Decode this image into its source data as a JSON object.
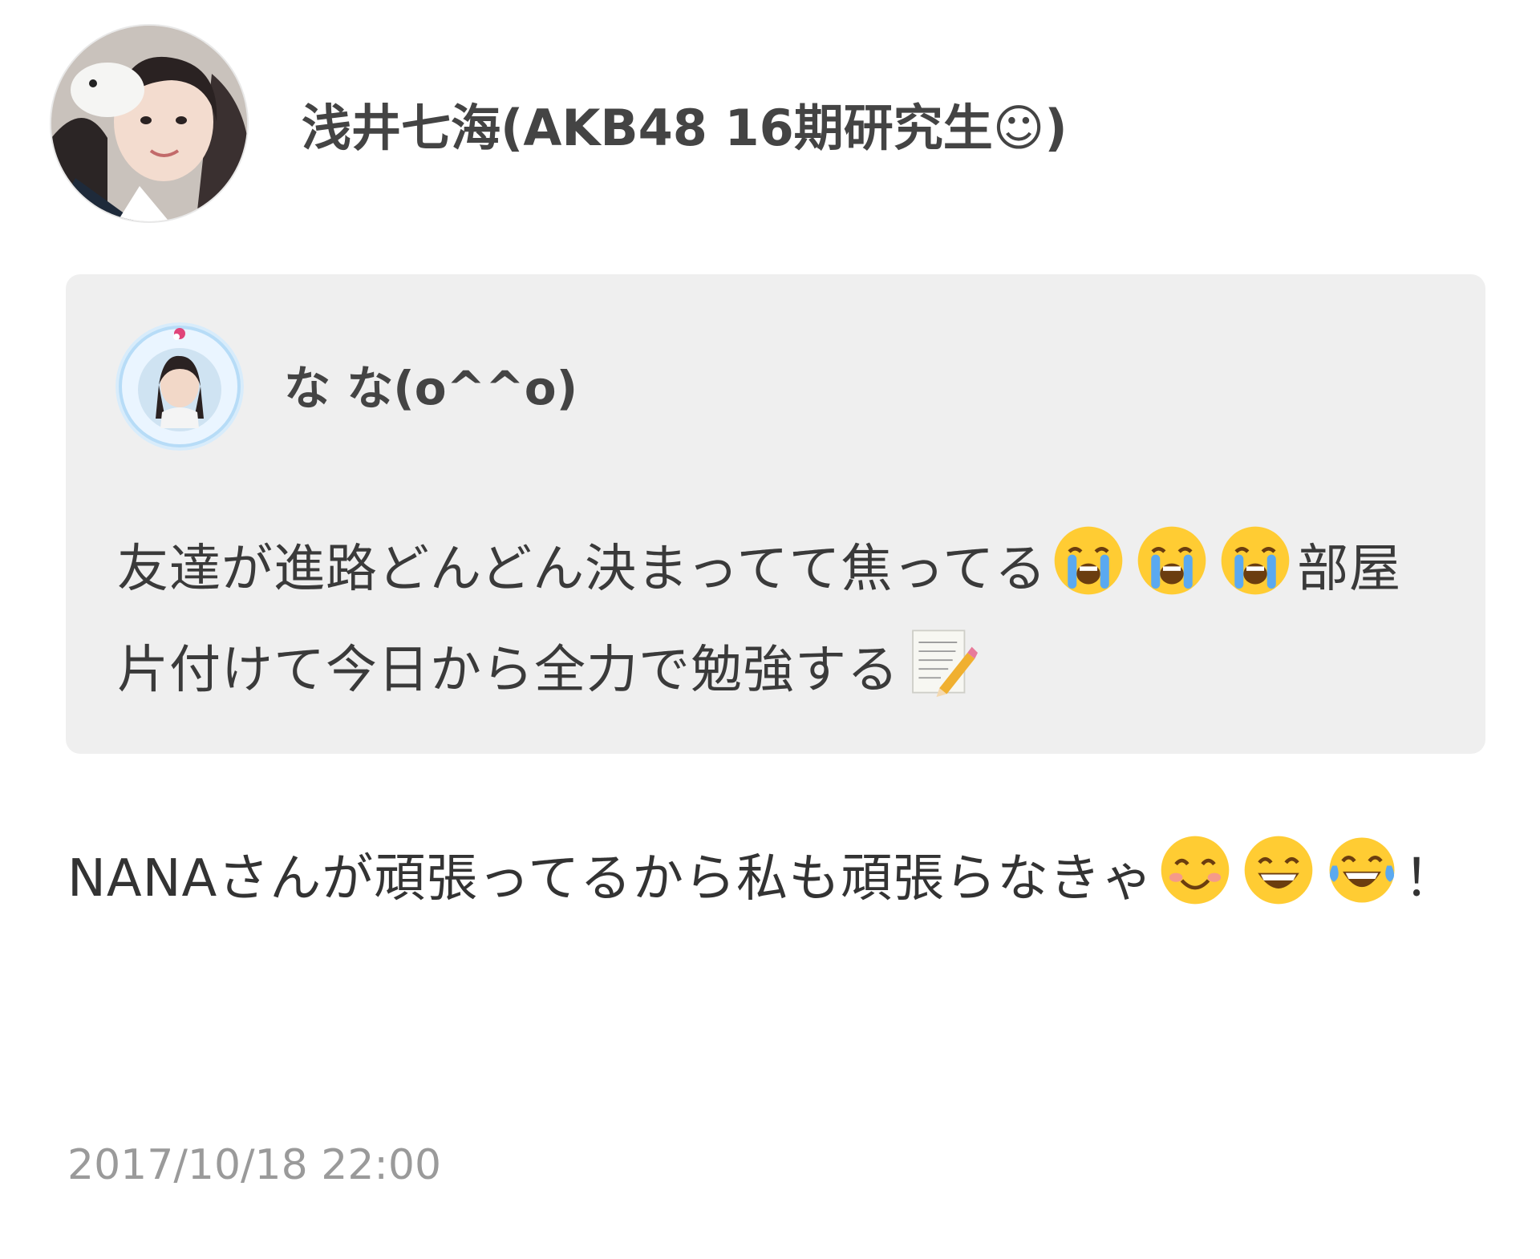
{
  "post": {
    "author_name": "浅井七海(AKB48 16期研究生☺)",
    "quote": {
      "author_name": "な な(o^^o)",
      "text_part1": "友達が進路どんどん決まってて焦ってる",
      "text_part2": "部屋片付けて今日から全力で勉強する"
    },
    "body": {
      "text_part1": "NANAさんが頑張ってるから私も頑張らなきゃ",
      "text_part2": "！"
    },
    "timestamp": "2017/10/18 22:00"
  },
  "icons": {
    "author_avatar": "avatar-photo-icon",
    "quote_avatar": "avatar-photo-icon",
    "crying_emoji": "loudly-crying-face-icon",
    "memo_emoji": "memo-pencil-icon",
    "smiling_emoji": "smiling-face-icon",
    "grinning_emoji": "grinning-face-icon",
    "tears_of_joy_emoji": "face-with-tears-of-joy-icon"
  },
  "colors": {
    "quote_background": "#efefef",
    "timestamp": "#9a9a9a"
  }
}
